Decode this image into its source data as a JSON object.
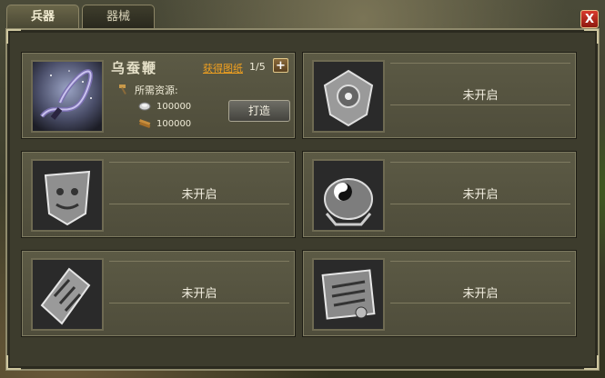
{
  "tabs": [
    {
      "label": "兵器",
      "active": true
    },
    {
      "label": "器械",
      "active": false
    }
  ],
  "close_label": "X",
  "weapon": {
    "name": "乌蚕鞭",
    "get_blueprint_label": "获得图纸",
    "blueprint_count": "1/5",
    "plus_label": "+",
    "required_label": "所需资源:",
    "resources": [
      {
        "icon": "silver-coin-icon",
        "amount": "100000"
      },
      {
        "icon": "wood-material-icon",
        "amount": "100000"
      }
    ],
    "forge_label": "打造"
  },
  "locked_slots": [
    {
      "label": "未开启",
      "icon": "shield-icon"
    },
    {
      "label": "未开启",
      "icon": "beast-shield-icon"
    },
    {
      "label": "未开启",
      "icon": "yin-yang-bell-icon"
    },
    {
      "label": "未开启",
      "icon": "scroll-armband-icon"
    },
    {
      "label": "未开启",
      "icon": "engraved-plate-icon"
    }
  ],
  "colors": {
    "link": "#f0a020",
    "panel": "#3d3c2d",
    "slot": "#5c5a45",
    "close": "#c8291c"
  }
}
